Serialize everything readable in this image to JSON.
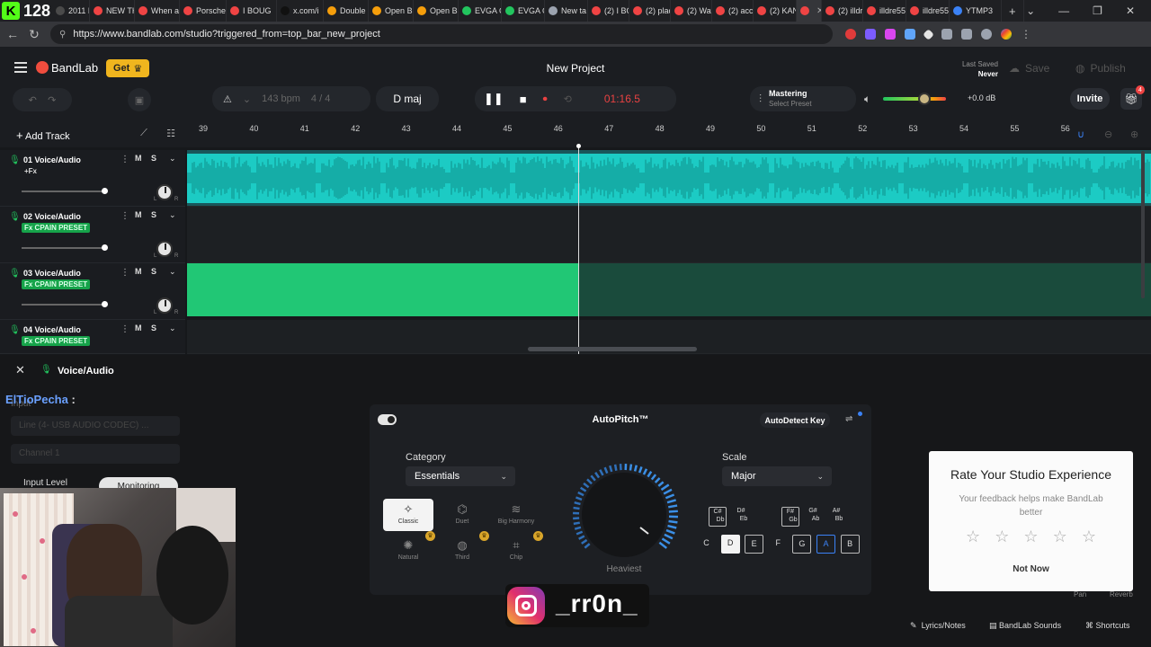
{
  "browser": {
    "kick_counter": "128",
    "tabs": [
      {
        "label": "2011 Po",
        "color": "#4a4a4a"
      },
      {
        "label": "NEW TH",
        "color": "#ef4444"
      },
      {
        "label": "When a",
        "color": "#ef4444"
      },
      {
        "label": "Porsche",
        "color": "#ef4444"
      },
      {
        "label": "I BOUG",
        "color": "#ef4444"
      },
      {
        "label": "x.com/i",
        "color": "#111111"
      },
      {
        "label": "Double",
        "color": "#f59e0b"
      },
      {
        "label": "Open B",
        "color": "#f59e0b"
      },
      {
        "label": "Open B",
        "color": "#f59e0b"
      },
      {
        "label": "EVGA G",
        "color": "#22c55e"
      },
      {
        "label": "EVGA G",
        "color": "#22c55e"
      },
      {
        "label": "New ta",
        "color": "#9ca3af"
      },
      {
        "label": "(2) I BO",
        "color": "#ef4444"
      },
      {
        "label": "(2) plac",
        "color": "#ef4444"
      },
      {
        "label": "(2) Way",
        "color": "#ef4444"
      },
      {
        "label": "(2) accu",
        "color": "#ef4444"
      },
      {
        "label": "(2) KAN",
        "color": "#ef4444"
      },
      {
        "label": "",
        "color": "#ef4444"
      },
      {
        "label": "(2) illdr",
        "color": "#ef4444"
      },
      {
        "label": "illdre55",
        "color": "#ef4444"
      },
      {
        "label": "illdre55",
        "color": "#ef4444"
      },
      {
        "label": "YTMP3",
        "color": "#3b82f6"
      }
    ],
    "url": "https://www.bandlab.com/studio?triggered_from=top_bar_new_project"
  },
  "header": {
    "brand": "BandLab",
    "get_label": "Get",
    "project_title": "New Project",
    "last_saved_label": "Last Saved",
    "last_saved_value": "Never",
    "save_label": "Save",
    "publish_label": "Publish",
    "invite_label": "Invite",
    "notification_count": "4"
  },
  "toolbar": {
    "bpm": "143 bpm",
    "time_signature": "4 / 4",
    "key": "D maj",
    "time": "01:16.5",
    "mastering_title": "Mastering",
    "mastering_sub": "Select Preset",
    "gain": "+0.0 dB",
    "volume_level": 0.66
  },
  "timeline": {
    "add_track_label": "Add Track",
    "bars": [
      "39",
      "40",
      "41",
      "42",
      "43",
      "44",
      "45",
      "46",
      "47",
      "48",
      "49",
      "50",
      "51",
      "52",
      "53",
      "54",
      "55",
      "56"
    ]
  },
  "tracks": [
    {
      "name": "01  Voice/Audio",
      "fx": "+Fx",
      "fx_style": "plain",
      "mute": "M",
      "solo": "S",
      "volume": 0.97,
      "l": "L",
      "r": "R"
    },
    {
      "name": "02  Voice/Audio",
      "fx": "Fx CPAIN PRESET",
      "fx_style": "preset",
      "mute": "M",
      "solo": "S",
      "volume": 0.97,
      "l": "L",
      "r": "R"
    },
    {
      "name": "03  Voice/Audio",
      "fx": "Fx CPAIN PRESET",
      "fx_style": "preset",
      "mute": "M",
      "solo": "S",
      "volume": 0.97,
      "l": "L",
      "r": "R"
    },
    {
      "name": "04  Voice/Audio",
      "fx": "Fx CPAIN PRESET",
      "fx_style": "preset",
      "mute": "M",
      "solo": "S",
      "volume": 0.97,
      "l": "L",
      "r": "R"
    }
  ],
  "bottom_panel": {
    "title": "Voice/Audio",
    "chat_user": "ElTioPecha",
    "chat_sep": ":",
    "input_label": "Input",
    "input_device": "Line (4- USB AUDIO CODEC) ...",
    "channel": "Channel 1",
    "input_level_label": "Input Level",
    "monitoring_label": "Monitoring"
  },
  "autopitch": {
    "title": "AutoPitch™",
    "autodetect_label": "AutoDetect Key",
    "category_label": "Category",
    "category_value": "Essentials",
    "presets": [
      {
        "label": "Classic",
        "icon": "✧",
        "active": true,
        "premium": false
      },
      {
        "label": "Duet",
        "icon": "⌬",
        "active": false,
        "premium": false
      },
      {
        "label": "Big Harmony",
        "icon": "≋",
        "active": false,
        "premium": false
      },
      {
        "label": "Natural",
        "icon": "✺",
        "active": false,
        "premium": true
      },
      {
        "label": "Third",
        "icon": "◍",
        "active": false,
        "premium": true
      },
      {
        "label": "Chip",
        "icon": "⌗",
        "active": false,
        "premium": true
      }
    ],
    "dial_label": "Heaviest",
    "scale_label": "Scale",
    "scale_value": "Major",
    "accidentals": [
      {
        "top": "C#",
        "bottom": "Db",
        "outlined": true
      },
      {
        "top": "D#",
        "bottom": "Eb",
        "outlined": false
      },
      {
        "top": "F#",
        "bottom": "Gb",
        "outlined": true
      },
      {
        "top": "G#",
        "bottom": "Ab",
        "outlined": false
      },
      {
        "top": "A#",
        "bottom": "Bb",
        "outlined": false
      }
    ],
    "naturals": [
      {
        "note": "C",
        "style": "plain"
      },
      {
        "note": "D",
        "style": "white"
      },
      {
        "note": "E",
        "style": "outlined"
      },
      {
        "note": "F",
        "style": "plain"
      },
      {
        "note": "G",
        "style": "outlined"
      },
      {
        "note": "A",
        "style": "blue"
      },
      {
        "note": "B",
        "style": "outlined"
      }
    ]
  },
  "rating": {
    "title": "Rate Your Studio Experience",
    "subtitle": "Your feedback helps make BandLab better",
    "stars": 5,
    "not_now_label": "Not Now",
    "pan_label": "Pan",
    "reverb_label": "Reverb"
  },
  "watermark": {
    "handle": "_rr0n_"
  },
  "footer": {
    "lyrics_label": "Lyrics/Notes",
    "sounds_label": "BandLab Sounds",
    "shortcuts_label": "Shortcuts"
  }
}
